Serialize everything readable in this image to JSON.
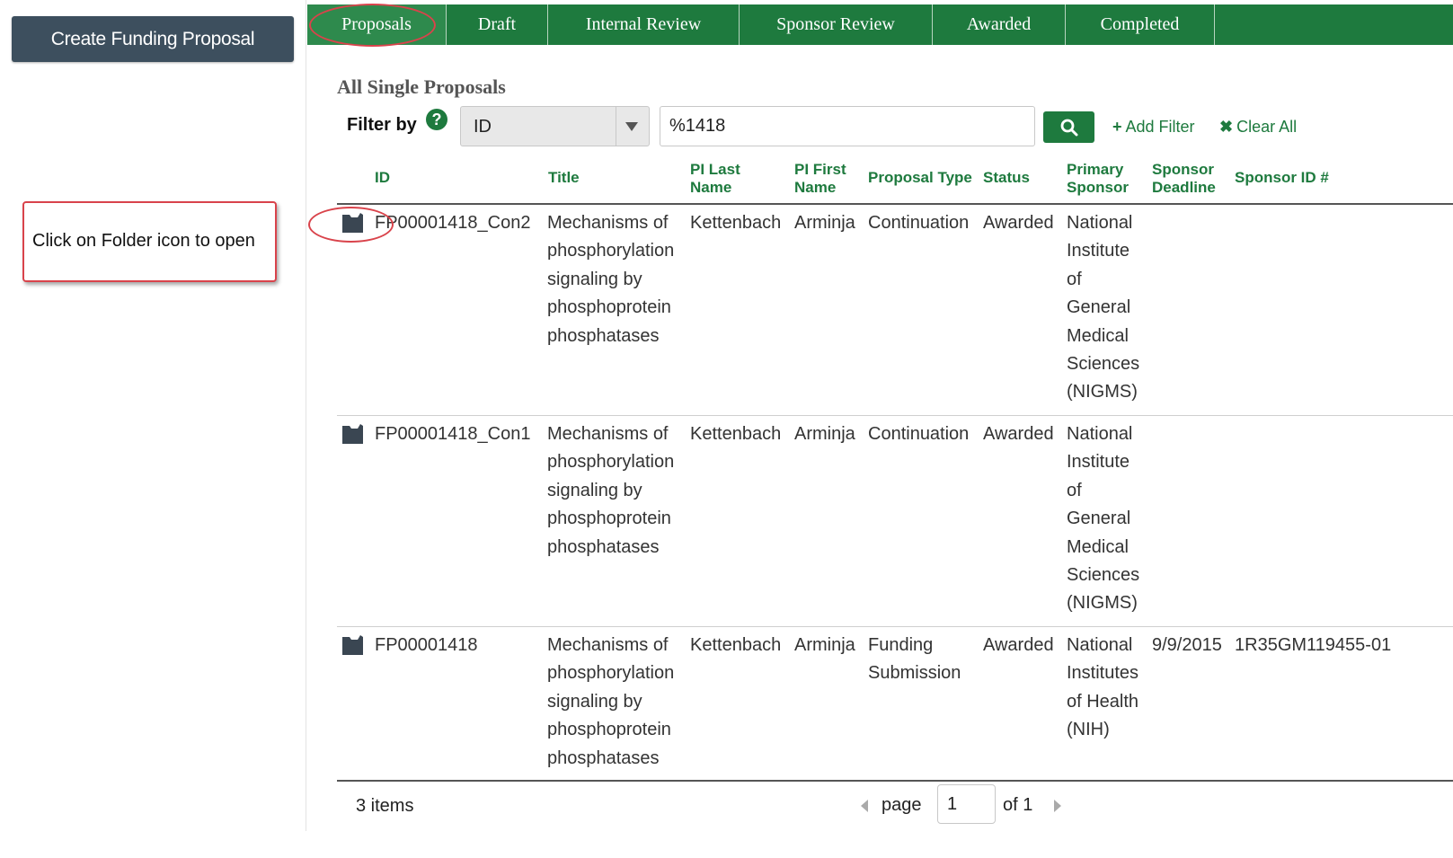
{
  "left": {
    "create_button": "Create Funding Proposal",
    "callout": "Click on Folder icon to open"
  },
  "tabs": [
    {
      "label": "Proposals",
      "active": true
    },
    {
      "label": "Draft"
    },
    {
      "label": "Internal Review"
    },
    {
      "label": "Sponsor Review"
    },
    {
      "label": "Awarded"
    },
    {
      "label": "Completed"
    }
  ],
  "section_title": "All Single Proposals",
  "filter": {
    "label": "Filter by",
    "help_glyph": "?",
    "field": "ID",
    "search_value": "%1418",
    "add_filter": "Add Filter",
    "clear_all": "Clear All"
  },
  "table": {
    "headers": {
      "id": "ID",
      "title": "Title",
      "pi_last_1": "PI Last",
      "pi_last_2": "Name",
      "pi_first_1": "PI First",
      "pi_first_2": "Name",
      "proposal_type": "Proposal Type",
      "status": "Status",
      "primary_sponsor_1": "Primary",
      "primary_sponsor_2": "Sponsor",
      "sponsor_deadline_1": "Sponsor",
      "sponsor_deadline_2": "Deadline",
      "sponsor_id": "Sponsor ID #"
    },
    "rows": [
      {
        "id": "FP00001418_Con2",
        "title": [
          "Mechanisms of",
          "phosphorylation",
          "signaling by",
          "phosphoprotein",
          "phosphatases"
        ],
        "pi_last": "Kettenbach",
        "pi_first": "Arminja",
        "proposal_type": [
          "Continuation"
        ],
        "status": "Awarded",
        "primary_sponsor": [
          "National",
          "Institute",
          "of",
          "General",
          "Medical",
          "Sciences",
          "(NIGMS)"
        ],
        "sponsor_deadline": "",
        "sponsor_id": ""
      },
      {
        "id": "FP00001418_Con1",
        "title": [
          "Mechanisms of",
          "phosphorylation",
          "signaling by",
          "phosphoprotein",
          "phosphatases"
        ],
        "pi_last": "Kettenbach",
        "pi_first": "Arminja",
        "proposal_type": [
          "Continuation"
        ],
        "status": "Awarded",
        "primary_sponsor": [
          "National",
          "Institute",
          "of",
          "General",
          "Medical",
          "Sciences",
          "(NIGMS)"
        ],
        "sponsor_deadline": "",
        "sponsor_id": ""
      },
      {
        "id": "FP00001418",
        "title": [
          "Mechanisms of",
          "phosphorylation",
          "signaling by",
          "phosphoprotein",
          "phosphatases"
        ],
        "pi_last": "Kettenbach",
        "pi_first": "Arminja",
        "proposal_type": [
          "Funding",
          "Submission"
        ],
        "status": "Awarded",
        "primary_sponsor": [
          "National",
          "Institutes",
          "of Health",
          "(NIH)"
        ],
        "sponsor_deadline": "9/9/2015",
        "sponsor_id": "1R35GM119455-01"
      }
    ]
  },
  "footer": {
    "items": "3 items",
    "page_label": "page",
    "page_value": "1",
    "of_label": "of 1"
  },
  "colors": {
    "accent": "#1e7a3e",
    "highlight": "#d9434b",
    "left_button": "#3d4f5e"
  }
}
